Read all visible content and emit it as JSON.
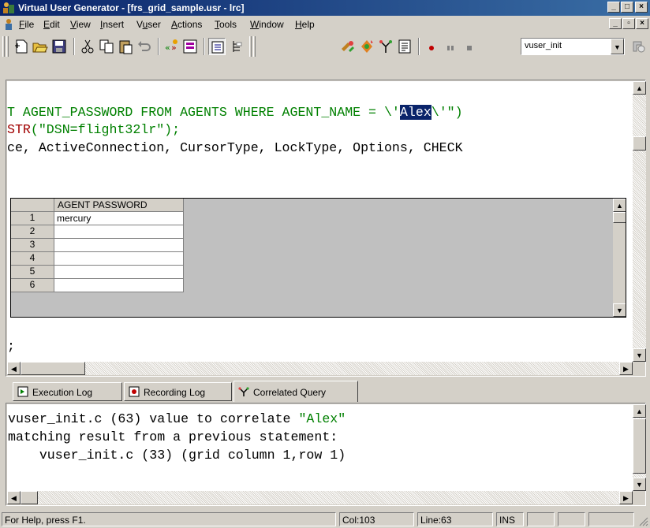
{
  "window": {
    "title": "Virtual User Generator - [frs_grid_sample.usr - lrc]"
  },
  "menu": {
    "items": [
      "File",
      "Edit",
      "View",
      "Insert",
      "Vuser",
      "Actions",
      "Tools",
      "Window",
      "Help"
    ],
    "underlines": [
      "F",
      "E",
      "V",
      "I",
      "u",
      "A",
      "T",
      "W",
      "H"
    ]
  },
  "toolbar": {
    "combo_value": "vuser_init",
    "icons": [
      "new-icon",
      "open-icon",
      "save-icon",
      "cut-icon",
      "copy-icon",
      "paste-icon",
      "undo-icon",
      "record-icon",
      "script-view-icon",
      "tree-view-icon",
      "grid-view-icon",
      "compile-icon",
      "run-icon",
      "stop-icon",
      "breakpoint-icon",
      "pause-icon",
      "step-icon"
    ]
  },
  "editor": {
    "line1_a": "T AGENT_PASSWORD FROM AGENTS WHERE AGENT_NAME = \\'",
    "line1_hl": "Alex",
    "line1_b": "\\'\")",
    "line2_fn": "STR",
    "line2_rest": "(\"DSN=flight32lr\");",
    "line3": "ce, ActiveConnection, CursorType, LockType, Options, CHECK",
    "line_end": ";"
  },
  "grid": {
    "column_header": "AGENT PASSWORD",
    "rows": [
      "1",
      "2",
      "3",
      "4",
      "5",
      "6"
    ],
    "values": [
      "mercury",
      "",
      "",
      "",
      "",
      ""
    ]
  },
  "tabs": [
    {
      "label": "Execution Log"
    },
    {
      "label": "Recording Log"
    },
    {
      "label": "Correlated Query"
    }
  ],
  "log": {
    "line1_a": "vuser_init.c (63) value to correlate ",
    "line1_str": "\"Alex\"",
    "line2": "matching result from a previous statement:",
    "line3": "    vuser_init.c (33) (grid column 1,row 1)"
  },
  "status": {
    "help": "For Help, press F1.",
    "col": "Col:103",
    "line": "Line:63",
    "mode": "INS"
  }
}
